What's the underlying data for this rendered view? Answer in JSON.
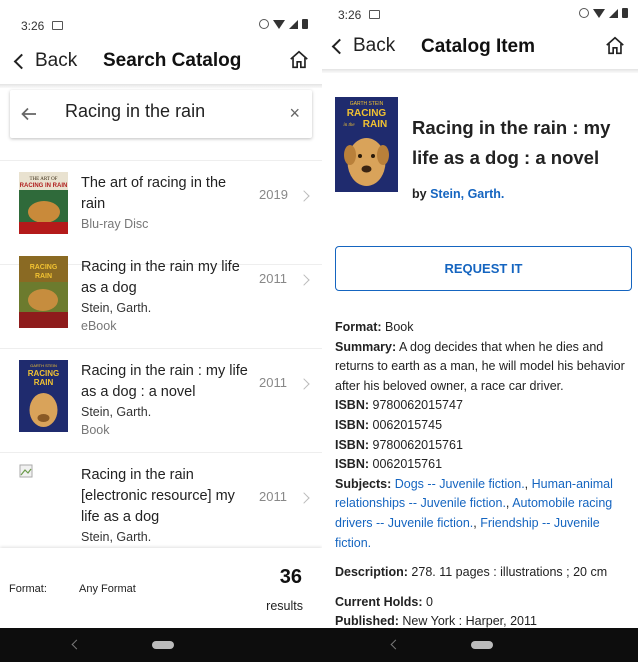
{
  "colors": {
    "accent": "#1565c0",
    "navbar": "#0d0d0d"
  },
  "left": {
    "status": {
      "time": "3:26"
    },
    "header": {
      "back_label": "Back",
      "title": "Search Catalog"
    },
    "search": {
      "query": "Racing in the rain",
      "clear_label": "×"
    },
    "results": [
      {
        "title": "The art of racing in the rain",
        "author": "",
        "format": "Blu-ray Disc",
        "year": "2019"
      },
      {
        "title": "Racing in the rain my life as a dog",
        "author": "Stein, Garth.",
        "format": "eBook",
        "year": "2011"
      },
      {
        "title": "Racing in the rain : my life as a dog : a novel",
        "author": "Stein, Garth.",
        "format": "Book",
        "year": "2011"
      },
      {
        "title": "Racing in the rain [electronic resource] my life as a dog",
        "author": "Stein, Garth.",
        "format": "",
        "year": "2011"
      }
    ],
    "footer": {
      "format_label": "Format:",
      "format_value": "Any Format",
      "count": "36",
      "count_label": "results"
    }
  },
  "right": {
    "status": {
      "time": "3:26"
    },
    "header": {
      "back_label": "Back",
      "title": "Catalog Item"
    },
    "item": {
      "cover_author": "GARTH STEIN",
      "cover_title": "RACING",
      "cover_in_the": "in the",
      "cover_rain": "RAIN",
      "title": "Racing in the rain : my life as a dog : a novel",
      "by_label": "by",
      "author": "Stein, Garth.",
      "request_label": "REQUEST IT",
      "format_label": "Format:",
      "format": "Book",
      "summary_label": "Summary:",
      "summary": "A dog decides that when he dies and returns to earth as a man, he will model his behavior after his beloved owner, a race car driver.",
      "isbn_label": "ISBN:",
      "isbns": [
        "9780062015747",
        "0062015745",
        "9780062015761",
        "0062015761"
      ],
      "subjects_label": "Subjects:",
      "subjects": [
        "Dogs -- Juvenile fiction.",
        "Human-animal relationships -- Juvenile fiction.",
        "Automobile racing drivers -- Juvenile fiction.",
        "Friendship -- Juvenile fiction."
      ],
      "description_label": "Description:",
      "description": "278. 11 pages : illustrations ; 20 cm",
      "holds_label": "Current Holds:",
      "holds": "0",
      "published_label": "Published:",
      "published": "New York : Harper, 2011"
    }
  }
}
